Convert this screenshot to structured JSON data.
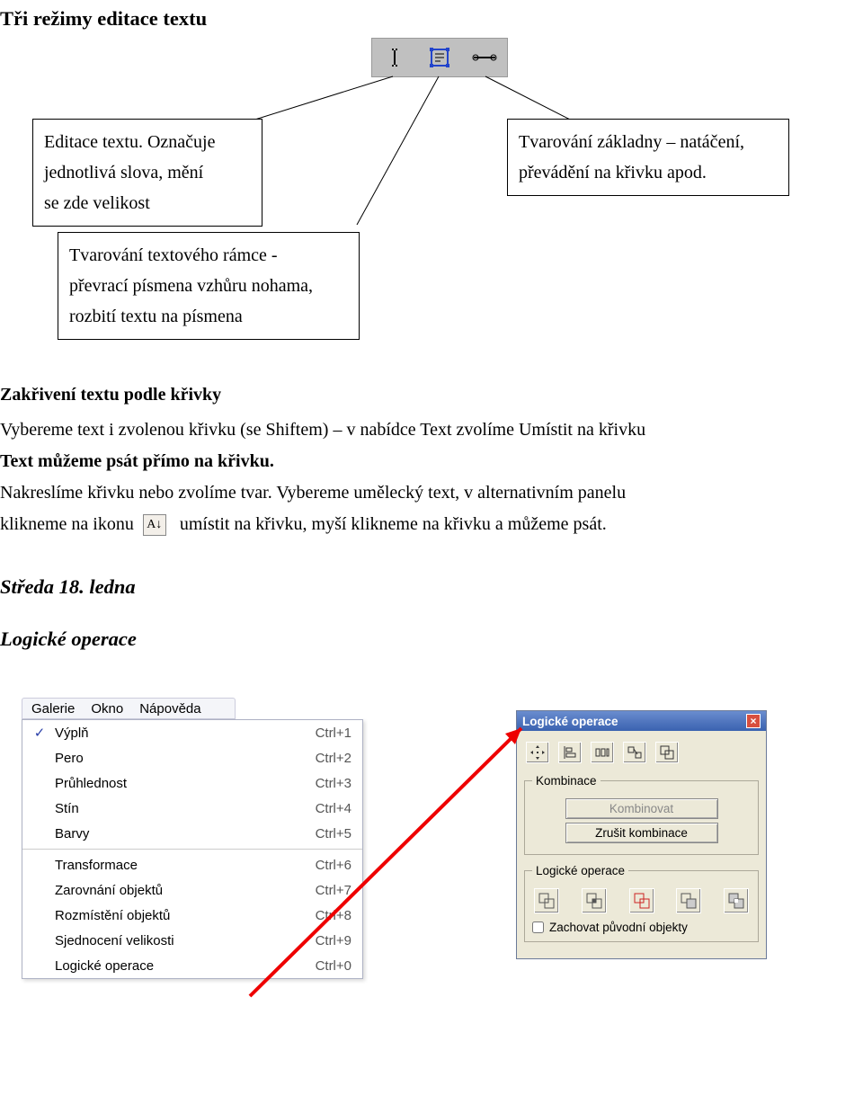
{
  "heading": "Tři režimy editace textu",
  "box1": {
    "line1": "Editace textu. Označuje",
    "line2": "jednotlivá slova, mění",
    "line3": "se zde velikost"
  },
  "box2": {
    "line1": "Tvarování základny – natáčení,",
    "line2": "převádění na křivku apod."
  },
  "box3": {
    "line1": "Tvarování textového rámce -",
    "line2": "převrací písmena vzhůru nohama,",
    "line3": "rozbití textu na písmena"
  },
  "subheading1": "Zakřivení textu podle křivky",
  "para": {
    "p1": "Vybereme text i zvolenou křivku (se Shiftem) – v nabídce Text zvolíme Umístit na křivku",
    "p2a": "Text můžeme psát přímo na křivku.",
    "p3": "Nakreslíme křivku nebo zvolíme tvar. Vybereme umělecký text, v alternativním panelu",
    "p4a": "klikneme na ikonu",
    "p4b": "umístit na křivku, myší klikneme na křivku a můžeme psát."
  },
  "date": "Středa 18. ledna",
  "italicHeading": "Logické operace",
  "inlineIcon": "A↓",
  "menubar": [
    "Galerie",
    "Okno",
    "Nápověda"
  ],
  "menu": [
    {
      "label": "Výplň",
      "shortcut": "Ctrl+1",
      "checked": true
    },
    {
      "label": "Pero",
      "shortcut": "Ctrl+2",
      "checked": false
    },
    {
      "label": "Průhlednost",
      "shortcut": "Ctrl+3",
      "checked": false
    },
    {
      "label": "Stín",
      "shortcut": "Ctrl+4",
      "checked": false
    },
    {
      "label": "Barvy",
      "shortcut": "Ctrl+5",
      "checked": false
    },
    {
      "hr": true
    },
    {
      "label": "Transformace",
      "shortcut": "Ctrl+6",
      "checked": false
    },
    {
      "label": "Zarovnání objektů",
      "shortcut": "Ctrl+7",
      "checked": false
    },
    {
      "label": "Rozmístění objektů",
      "shortcut": "Ctrl+8",
      "checked": false
    },
    {
      "label": "Sjednocení velikosti",
      "shortcut": "Ctrl+9",
      "checked": false
    },
    {
      "label": "Logické operace",
      "shortcut": "Ctrl+0",
      "checked": false
    }
  ],
  "dialog": {
    "title": "Logické operace",
    "group1": "Kombinace",
    "btn1": "Kombinovat",
    "btn2": "Zrušit kombinace",
    "group2": "Logické operace",
    "checkbox": "Zachovat původní objekty"
  }
}
